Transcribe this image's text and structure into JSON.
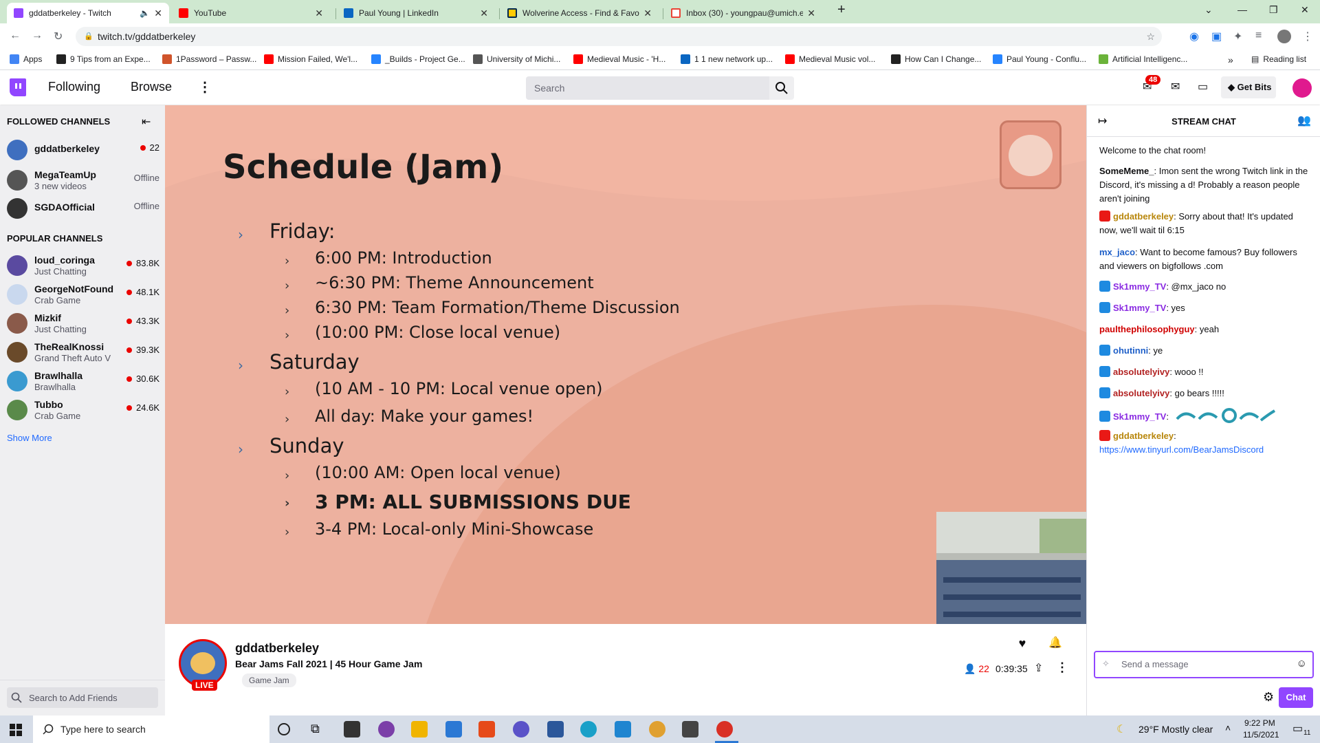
{
  "browser": {
    "tabs": [
      {
        "title": "gddatberkeley - Twitch",
        "color": "#9146ff",
        "active": true
      },
      {
        "title": "YouTube",
        "color": "#ff0000"
      },
      {
        "title": "Paul Young | LinkedIn",
        "color": "#0a66c2"
      },
      {
        "title": "Wolverine Access - Find & Favori",
        "color": "#00274c"
      },
      {
        "title": "Inbox (30) - youngpau@umich.e",
        "color": "#ea4335"
      }
    ],
    "url": "twitch.tv/gddatberkeley",
    "bookmarks": [
      {
        "label": "Apps",
        "color": "#4285f4"
      },
      {
        "label": "9 Tips from an Expe...",
        "color": "#222222"
      },
      {
        "label": "1Password – Passw...",
        "color": "#d0542b"
      },
      {
        "label": "Mission Failed, We'l...",
        "color": "#ff0000"
      },
      {
        "label": "_Builds - Project Ge...",
        "color": "#2684ff"
      },
      {
        "label": "University of Michi...",
        "color": "#555555"
      },
      {
        "label": "Medieval Music - 'H...",
        "color": "#ff0000"
      },
      {
        "label": "1 1 new network up...",
        "color": "#0a66c2"
      },
      {
        "label": "Medieval Music vol...",
        "color": "#ff0000"
      },
      {
        "label": "How Can I Change...",
        "color": "#222222"
      },
      {
        "label": "Paul Young - Conflu...",
        "color": "#2684ff"
      },
      {
        "label": "Artificial Intelligenc...",
        "color": "#6bb33a"
      }
    ],
    "reading_list": "Reading list"
  },
  "nav": {
    "following": "Following",
    "browse": "Browse",
    "search_placeholder": "Search",
    "notif_count": "48",
    "get_bits": "Get Bits"
  },
  "sidebar": {
    "followed_heading": "FOLLOWED CHANNELS",
    "followed": [
      {
        "name": "gddatberkeley",
        "sub": "",
        "status": "22",
        "live": true,
        "color": "#3f6fbf"
      },
      {
        "name": "MegaTeamUp",
        "sub": "3 new videos",
        "status": "Offline",
        "live": false,
        "color": "#555555"
      },
      {
        "name": "SGDAOfficial",
        "sub": "",
        "status": "Offline",
        "live": false,
        "color": "#333333"
      }
    ],
    "popular_heading": "POPULAR CHANNELS",
    "popular": [
      {
        "name": "loud_coringa",
        "sub": "Just Chatting",
        "status": "83.8K",
        "color": "#5a4aa0"
      },
      {
        "name": "GeorgeNotFound",
        "sub": "Crab Game",
        "status": "48.1K",
        "color": "#c9d8ee"
      },
      {
        "name": "Mizkif",
        "sub": "Just Chatting",
        "status": "43.3K",
        "color": "#8a5a4a"
      },
      {
        "name": "TheRealKnossi",
        "sub": "Grand Theft Auto V",
        "status": "39.3K",
        "color": "#6a4a2a"
      },
      {
        "name": "Brawlhalla",
        "sub": "Brawlhalla",
        "status": "30.6K",
        "color": "#3a9ad0"
      },
      {
        "name": "Tubbo",
        "sub": "Crab Game",
        "status": "24.6K",
        "color": "#5a8a4a"
      }
    ],
    "show_more": "Show More",
    "friends_search_placeholder": "Search to Add Friends"
  },
  "stream": {
    "slide_title": "Schedule (Jam)",
    "days": [
      {
        "day": "Friday:",
        "items": [
          "6:00 PM: Introduction",
          "~6:30 PM: Theme Announcement",
          "6:30 PM: Team Formation/Theme Discussion",
          "(10:00 PM: Close local venue)"
        ]
      },
      {
        "day": "Saturday",
        "items": [
          "(10 AM - 10 PM: Local venue open)",
          "All day: Make your games!"
        ]
      },
      {
        "day": "Sunday",
        "items": [
          "(10:00 AM: Open local venue)",
          "3 PM: ALL SUBMISSIONS DUE",
          "3-4 PM: Local-only Mini-Showcase"
        ]
      }
    ],
    "channel_name": "gddatberkeley",
    "stream_title": "Bear Jams Fall 2021 | 45 Hour Game Jam",
    "tag": "Game Jam",
    "live_label": "LIVE",
    "viewers": "22",
    "uptime": "0:39:35"
  },
  "chat": {
    "header": "STREAM CHAT",
    "welcome": "Welcome to the chat room!",
    "messages": [
      {
        "user": "SomeMeme_",
        "color": "#0e0e10",
        "badge": "",
        "text": ": Imon sent the wrong Twitch link in the Discord, it's missing a d! Probably a reason people aren't joining"
      },
      {
        "user": "gddatberkeley",
        "color": "#b8860b",
        "badge": "#e91916",
        "text": ": Sorry about that! It's updated now, we'll wait til 6:15"
      },
      {
        "user": "mx_jaco",
        "color": "#1e5fc8",
        "badge": "",
        "text": ": Want to become famous? Buy followers and viewers on bigfollows .com"
      },
      {
        "user": "Sk1mmy_TV",
        "color": "#8a2be2",
        "badge": "#1e8ae0",
        "text": ": @mx_jaco no"
      },
      {
        "user": "Sk1mmy_TV",
        "color": "#8a2be2",
        "badge": "#1e8ae0",
        "text": ": yes"
      },
      {
        "user": "paulthephilosophyguy",
        "color": "#d00000",
        "badge": "",
        "text": ": yeah"
      },
      {
        "user": "ohutinni",
        "color": "#1e5fc8",
        "badge": "#1e8ae0",
        "text": ": ye"
      },
      {
        "user": "absolutelyivy",
        "color": "#b22222",
        "badge": "#1e8ae0",
        "text": ": wooo !!"
      },
      {
        "user": "absolutelyivy",
        "color": "#b22222",
        "badge": "#1e8ae0",
        "text": ": go bears !!!!!"
      },
      {
        "user": "Sk1mmy_TV",
        "color": "#8a2be2",
        "badge": "#1e8ae0",
        "text": ":"
      },
      {
        "user": "gddatberkeley",
        "color": "#b8860b",
        "badge": "#e91916",
        "text": ":"
      }
    ],
    "link": "https://www.tinyurl.com/BearJamsDiscord",
    "input_placeholder": "Send a message",
    "chat_button": "Chat"
  },
  "taskbar": {
    "search_placeholder": "Type here to search",
    "weather": "29°F  Mostly clear",
    "time": "9:22 PM",
    "date": "11/5/2021",
    "notif": "11"
  }
}
